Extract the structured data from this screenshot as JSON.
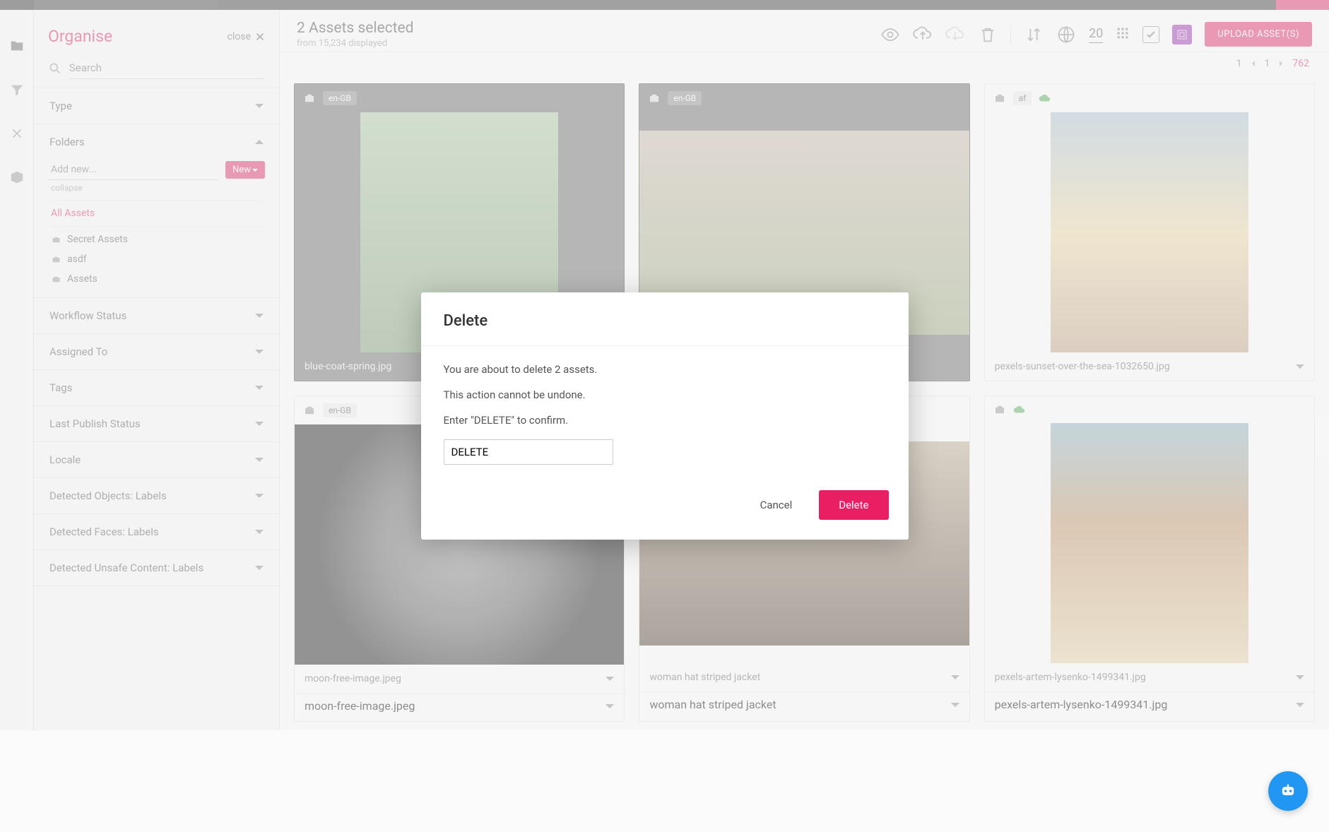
{
  "panel": {
    "title": "Organise",
    "close_label": "close",
    "search_placeholder": "Search"
  },
  "filters": {
    "type": "Type",
    "folders": "Folders",
    "workflow": "Workflow Status",
    "assigned": "Assigned To",
    "tags": "Tags",
    "publish": "Last Publish Status",
    "locale": "Locale",
    "det_obj": "Detected Objects: Labels",
    "det_face": "Detected Faces: Labels",
    "det_unsafe": "Detected Unsafe Content: Labels"
  },
  "folders": {
    "add_placeholder": "Add new...",
    "new_btn": "New",
    "collapse": "collapse",
    "items": [
      {
        "label": "All Assets",
        "selected": true,
        "icon": false
      },
      {
        "label": "Secret Assets",
        "selected": false,
        "icon": true
      },
      {
        "label": "asdf",
        "selected": false,
        "icon": true
      },
      {
        "label": "Assets",
        "selected": false,
        "icon": true
      }
    ]
  },
  "toolbar": {
    "sel_title": "2 Assets selected",
    "sel_sub": "from 15,234 displayed",
    "page_size": "20",
    "upload": "UPLOAD ASSET(S)"
  },
  "pager": {
    "current": "1",
    "input": "1",
    "total": "762"
  },
  "assets": [
    {
      "locale": "en-GB",
      "selected": true,
      "filename": "blue-coat-spring.jpg",
      "thumb": "spring",
      "cloud": false
    },
    {
      "locale": "en-GB",
      "selected": true,
      "filename": "",
      "thumb": "blossom",
      "cloud": false
    },
    {
      "locale": "af",
      "selected": false,
      "filename": "pexels-sunset-over-the-sea-1032650.jpg",
      "thumb": "sunset",
      "cloud": true
    },
    {
      "locale": "en-GB",
      "selected": false,
      "filename": "moon-free-image.jpeg",
      "filename2": "moon-free-image.jpeg",
      "thumb": "moon",
      "cloud": false
    },
    {
      "locale": "",
      "selected": false,
      "filename": "woman hat striped jacket",
      "filename2": "woman hat striped jacket",
      "thumb": "woman",
      "cloud": true
    },
    {
      "locale": "",
      "selected": false,
      "filename": "pexels-artem-lysenko-1499341.jpg",
      "filename2": "pexels-artem-lysenko-1499341.jpg",
      "thumb": "rocks",
      "cloud": true
    }
  ],
  "modal": {
    "title": "Delete",
    "line1": "You are about to delete 2 assets.",
    "line2": "This action cannot be undone.",
    "line3": "Enter \"DELETE\" to confirm.",
    "input_value": "DELETE",
    "cancel": "Cancel",
    "confirm": "Delete"
  }
}
